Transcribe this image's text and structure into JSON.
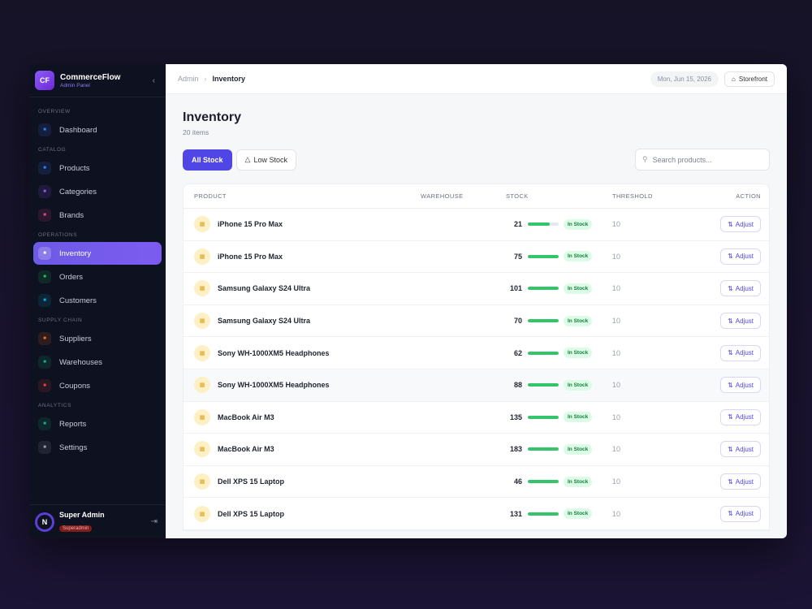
{
  "brand": {
    "initials": "CF",
    "name": "CommerceFlow",
    "subtitle": "Admin Panel"
  },
  "sidebar": {
    "sections": [
      {
        "label": "OVERVIEW",
        "items": [
          {
            "label": "Dashboard",
            "icon": "grid-icon",
            "color": "#3b82f6"
          }
        ]
      },
      {
        "label": "CATALOG",
        "items": [
          {
            "label": "Products",
            "icon": "box-icon",
            "color": "#3b82f6"
          },
          {
            "label": "Categories",
            "icon": "table-icon",
            "color": "#8b5cf6"
          },
          {
            "label": "Brands",
            "icon": "tag-icon",
            "color": "#ec4899"
          }
        ]
      },
      {
        "label": "OPERATIONS",
        "items": [
          {
            "label": "Inventory",
            "icon": "warehouse-icon",
            "color": "#ffffff",
            "active": true
          },
          {
            "label": "Orders",
            "icon": "receipt-icon",
            "color": "#22c55e"
          },
          {
            "label": "Customers",
            "icon": "users-icon",
            "color": "#06b6d4"
          }
        ]
      },
      {
        "label": "SUPPLY CHAIN",
        "items": [
          {
            "label": "Suppliers",
            "icon": "truck-icon",
            "color": "#f97316"
          },
          {
            "label": "Warehouses",
            "icon": "building-icon",
            "color": "#10b981"
          },
          {
            "label": "Coupons",
            "icon": "percent-icon",
            "color": "#ef4444"
          }
        ]
      },
      {
        "label": "ANALYTICS",
        "items": [
          {
            "label": "Reports",
            "icon": "chart-icon",
            "color": "#10b981"
          },
          {
            "label": "Settings",
            "icon": "gear-icon",
            "color": "#9ca3af"
          }
        ]
      }
    ]
  },
  "user": {
    "avatar_letter": "N",
    "name": "Super Admin",
    "role": "Superadmin"
  },
  "topbar": {
    "breadcrumb_root": "Admin",
    "breadcrumb_current": "Inventory",
    "date": "Mon, Jun 15, 2026",
    "storefront_label": "Storefront"
  },
  "page": {
    "title": "Inventory",
    "count": "20 items"
  },
  "filters": {
    "all_label": "All Stock",
    "low_label": "Low Stock",
    "search_placeholder": "Search products..."
  },
  "table": {
    "columns": [
      "PRODUCT",
      "WAREHOUSE",
      "STOCK",
      "THRESHOLD",
      "ACTION"
    ],
    "adjust_label": "Adjust",
    "rows": [
      {
        "product": "iPhone 15 Pro Max",
        "warehouse": "",
        "stock": "21",
        "fill": 0.7,
        "status": "In Stock",
        "threshold": "10"
      },
      {
        "product": "iPhone 15 Pro Max",
        "warehouse": "",
        "stock": "75",
        "fill": 1.0,
        "status": "In Stock",
        "threshold": "10"
      },
      {
        "product": "Samsung Galaxy S24 Ultra",
        "warehouse": "",
        "stock": "101",
        "fill": 1.0,
        "status": "In Stock",
        "threshold": "10"
      },
      {
        "product": "Samsung Galaxy S24 Ultra",
        "warehouse": "",
        "stock": "70",
        "fill": 1.0,
        "status": "In Stock",
        "threshold": "10"
      },
      {
        "product": "Sony WH-1000XM5 Headphones",
        "warehouse": "",
        "stock": "62",
        "fill": 1.0,
        "status": "In Stock",
        "threshold": "10"
      },
      {
        "product": "Sony WH-1000XM5 Headphones",
        "warehouse": "",
        "stock": "88",
        "fill": 1.0,
        "status": "In Stock",
        "threshold": "10",
        "hover": true
      },
      {
        "product": "MacBook Air M3",
        "warehouse": "",
        "stock": "135",
        "fill": 1.0,
        "status": "In Stock",
        "threshold": "10"
      },
      {
        "product": "MacBook Air M3",
        "warehouse": "",
        "stock": "183",
        "fill": 1.0,
        "status": "In Stock",
        "threshold": "10"
      },
      {
        "product": "Dell XPS 15 Laptop",
        "warehouse": "",
        "stock": "46",
        "fill": 1.0,
        "status": "In Stock",
        "threshold": "10"
      },
      {
        "product": "Dell XPS 15 Laptop",
        "warehouse": "",
        "stock": "131",
        "fill": 1.0,
        "status": "In Stock",
        "threshold": "10"
      }
    ]
  }
}
